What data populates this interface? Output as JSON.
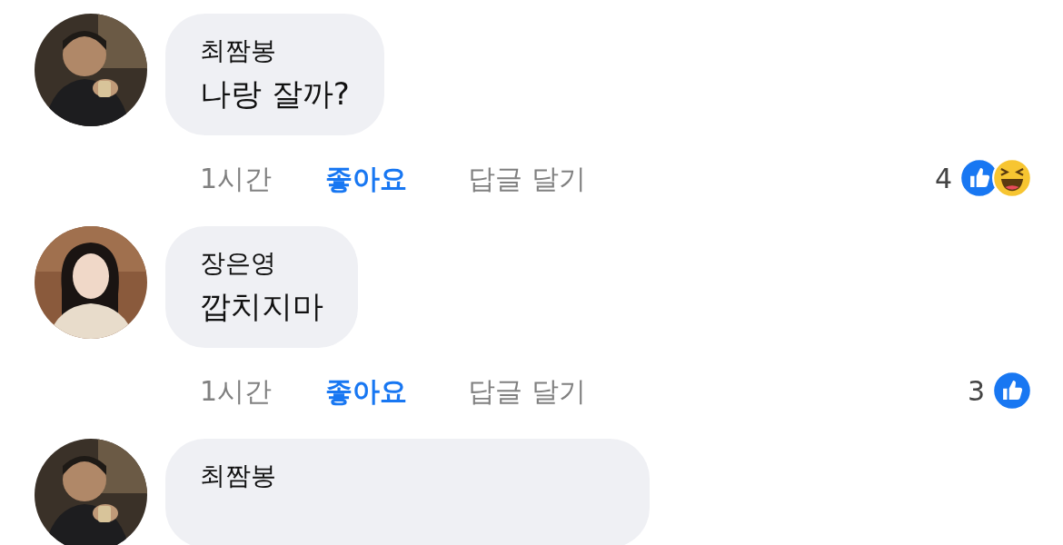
{
  "comments": [
    {
      "author": "최짬봉",
      "message": "나랑 잘까?",
      "time": "1시간",
      "like_label": "좋아요",
      "liked": true,
      "reply_label": "답글 달기",
      "reaction_count": "4",
      "reactions": [
        {
          "kind": "like"
        },
        {
          "kind": "haha"
        }
      ],
      "avatar": {
        "kind": "picture"
      }
    },
    {
      "author": "장은영",
      "message": "깝치지마",
      "time": "1시간",
      "like_label": "좋아요",
      "liked": true,
      "reply_label": "답글 달기",
      "reaction_count": "3",
      "reactions": [
        {
          "kind": "like"
        }
      ],
      "avatar": {
        "kind": "picture"
      }
    },
    {
      "author": "최짬봉",
      "avatar": {
        "kind": "picture"
      }
    }
  ]
}
